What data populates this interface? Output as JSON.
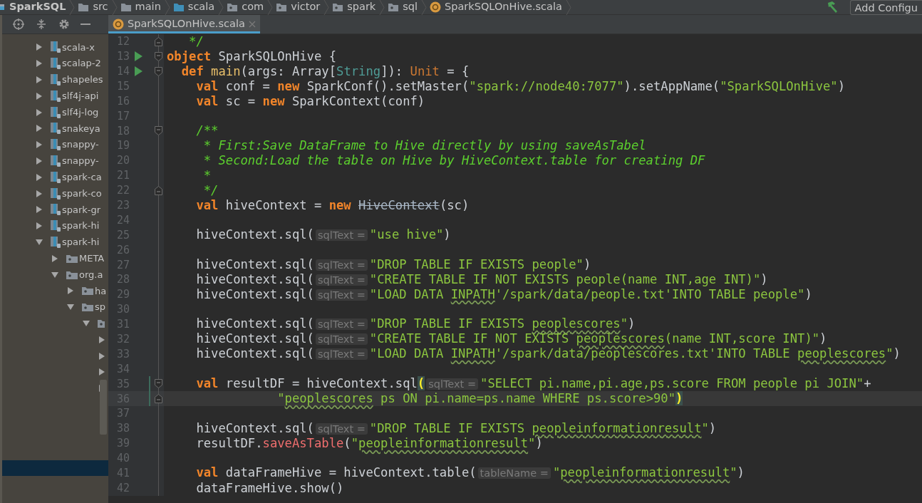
{
  "breadcrumbs": [
    {
      "label": "SparkSQL",
      "kind": "module"
    },
    {
      "label": "src",
      "kind": "folder"
    },
    {
      "label": "main",
      "kind": "folder"
    },
    {
      "label": "scala",
      "kind": "source_folder"
    },
    {
      "label": "com",
      "kind": "package"
    },
    {
      "label": "victor",
      "kind": "package"
    },
    {
      "label": "spark",
      "kind": "package"
    },
    {
      "label": "sql",
      "kind": "package"
    },
    {
      "label": "SparkSQLOnHive.scala",
      "kind": "scala_object"
    }
  ],
  "run_config": {
    "label": "Add Configu"
  },
  "tabs": [
    {
      "label": "SparkSQLOnHive.scala",
      "selected": true
    }
  ],
  "sidebar": {
    "selected_row": true,
    "tree": [
      {
        "label": "scala-x",
        "kind": "jar",
        "expanded": false
      },
      {
        "label": "scalap-2",
        "kind": "jar",
        "expanded": false
      },
      {
        "label": "shapeles",
        "kind": "jar",
        "expanded": false
      },
      {
        "label": "slf4j-api",
        "kind": "jar",
        "expanded": false
      },
      {
        "label": "slf4j-log",
        "kind": "jar",
        "expanded": false
      },
      {
        "label": "snakeya",
        "kind": "jar",
        "expanded": false
      },
      {
        "label": "snappy-",
        "kind": "jar",
        "expanded": false
      },
      {
        "label": "snappy-",
        "kind": "jar",
        "expanded": false
      },
      {
        "label": "spark-ca",
        "kind": "jar",
        "expanded": false
      },
      {
        "label": "spark-co",
        "kind": "jar",
        "expanded": false
      },
      {
        "label": "spark-gr",
        "kind": "jar",
        "expanded": false
      },
      {
        "label": "spark-hi",
        "kind": "jar",
        "expanded": false
      },
      {
        "label": "spark-hi",
        "kind": "jar",
        "expanded": true,
        "children": [
          {
            "label": "META",
            "kind": "package",
            "expanded": false
          },
          {
            "label": "org.a",
            "kind": "package",
            "expanded": true,
            "children": [
              {
                "label": "ha",
                "kind": "package",
                "expanded": false
              },
              {
                "label": "sp",
                "kind": "package",
                "expanded": true,
                "children": [
                  {
                    "kind": "package",
                    "expanded": true,
                    "children": [
                      {
                        "expanded": false
                      },
                      {
                        "expanded": false
                      },
                      {
                        "expanded": false
                      },
                      {
                        "expanded": false
                      }
                    ]
                  }
                ]
              }
            ]
          }
        ]
      }
    ]
  },
  "editor": {
    "lines": [
      {
        "n": "12",
        "fold": {
          "kind": "end"
        },
        "current": false,
        "changed": false,
        "tokens": [
          {
            "kind": "comment",
            "t": "   */"
          }
        ]
      },
      {
        "n": "13",
        "fold": {
          "kind": "start"
        },
        "marker": {
          "kind": "run"
        },
        "current": false,
        "changed": false,
        "tokens": [
          {
            "kind": "keyword",
            "t": "object"
          },
          {
            "kind": "text",
            "t": " SparkSQLOnHive {"
          }
        ]
      },
      {
        "n": "14",
        "fold": {
          "kind": "start"
        },
        "marker": {
          "kind": "run"
        },
        "current": false,
        "changed": false,
        "tokens": [
          {
            "kind": "keyword",
            "t": "  def"
          },
          {
            "kind": "fn",
            "t": " main"
          },
          {
            "kind": "text",
            "t": "(args: Array["
          },
          {
            "kind": "type",
            "t": "String"
          },
          {
            "kind": "text",
            "t": "]): "
          },
          {
            "kind": "unit",
            "t": "Unit"
          },
          {
            "kind": "text",
            "t": " = {"
          }
        ]
      },
      {
        "n": "15",
        "current": false,
        "changed": false,
        "tokens": [
          {
            "kind": "keyword",
            "t": "    val"
          },
          {
            "kind": "text",
            "t": " conf = "
          },
          {
            "kind": "keyword",
            "t": "new"
          },
          {
            "kind": "text",
            "t": " SparkConf().setMaster("
          },
          {
            "kind": "string",
            "t": "\"spark://node40:7077\""
          },
          {
            "kind": "text",
            "t": ").setAppName("
          },
          {
            "kind": "string",
            "t": "\"SparkSQLOnHive\""
          },
          {
            "kind": "text",
            "t": ")"
          }
        ]
      },
      {
        "n": "16",
        "current": false,
        "changed": false,
        "tokens": [
          {
            "kind": "keyword",
            "t": "    val"
          },
          {
            "kind": "text",
            "t": " sc = "
          },
          {
            "kind": "keyword",
            "t": "new"
          },
          {
            "kind": "text",
            "t": " SparkContext(conf)"
          }
        ]
      },
      {
        "n": "17",
        "current": false,
        "changed": false
      },
      {
        "n": "18",
        "fold": {
          "kind": "start"
        },
        "current": false,
        "changed": false,
        "tokens": [
          {
            "kind": "comment",
            "t": "    /**"
          }
        ]
      },
      {
        "n": "19",
        "current": false,
        "changed": false,
        "tokens": [
          {
            "kind": "comment",
            "t": "     * First:Save DataFrame to Hive directly by using saveAsTabel"
          }
        ]
      },
      {
        "n": "20",
        "current": false,
        "changed": false,
        "tokens": [
          {
            "kind": "comment",
            "t": "     * Second:Load the table on Hive by HiveContext.table for creating DF"
          }
        ]
      },
      {
        "n": "21",
        "current": false,
        "changed": false,
        "tokens": [
          {
            "kind": "comment",
            "t": "     *"
          }
        ]
      },
      {
        "n": "22",
        "fold": {
          "kind": "end"
        },
        "current": false,
        "changed": false,
        "tokens": [
          {
            "kind": "comment",
            "t": "     */"
          }
        ]
      },
      {
        "n": "23",
        "current": false,
        "changed": false,
        "tokens": [
          {
            "kind": "keyword",
            "t": "    val"
          },
          {
            "kind": "text",
            "t": " hiveContext = "
          },
          {
            "kind": "keyword",
            "t": "new "
          },
          {
            "kind": "deprecated",
            "t": "HiveContext"
          },
          {
            "kind": "text",
            "t": "(sc)"
          }
        ]
      },
      {
        "n": "24",
        "current": false,
        "changed": false
      },
      {
        "n": "25",
        "current": false,
        "changed": false,
        "tokens": [
          {
            "kind": "text",
            "t": "    hiveContext.sql("
          },
          {
            "kind": "hint",
            "t": "sqlText ="
          },
          {
            "kind": "string",
            "t": "\"use hive\""
          },
          {
            "kind": "text",
            "t": ")"
          }
        ]
      },
      {
        "n": "26",
        "current": false,
        "changed": false
      },
      {
        "n": "27",
        "current": false,
        "changed": false,
        "tokens": [
          {
            "kind": "text",
            "t": "    hiveContext.sql("
          },
          {
            "kind": "hint",
            "t": "sqlText ="
          },
          {
            "kind": "string",
            "t": "\"DROP TABLE IF EXISTS people\""
          },
          {
            "kind": "text",
            "t": ")"
          }
        ]
      },
      {
        "n": "28",
        "current": false,
        "changed": false,
        "tokens": [
          {
            "kind": "text",
            "t": "    hiveContext.sql("
          },
          {
            "kind": "hint",
            "t": "sqlText ="
          },
          {
            "kind": "string",
            "t": "\"CREATE TABLE IF NOT EXISTS people(name INT,age INT)\""
          },
          {
            "kind": "text",
            "t": ")"
          }
        ]
      },
      {
        "n": "29",
        "current": false,
        "changed": false,
        "tokens": [
          {
            "kind": "text",
            "t": "    hiveContext.sql("
          },
          {
            "kind": "hint",
            "t": "sqlText ="
          },
          {
            "kind": "string",
            "t": "\"LOAD DATA "
          },
          {
            "kind": "typo",
            "t": "INPATH"
          },
          {
            "kind": "string",
            "t": "'/spark/data/people.txt'INTO TABLE people\""
          },
          {
            "kind": "text",
            "t": ")"
          }
        ]
      },
      {
        "n": "30",
        "current": false,
        "changed": false
      },
      {
        "n": "31",
        "current": false,
        "changed": false,
        "tokens": [
          {
            "kind": "text",
            "t": "    hiveContext.sql("
          },
          {
            "kind": "hint",
            "t": "sqlText ="
          },
          {
            "kind": "string",
            "t": "\"DROP TABLE IF EXISTS "
          },
          {
            "kind": "typo",
            "t": "peoplescores"
          },
          {
            "kind": "string",
            "t": "\""
          },
          {
            "kind": "text",
            "t": ")"
          }
        ]
      },
      {
        "n": "32",
        "current": false,
        "changed": false,
        "tokens": [
          {
            "kind": "text",
            "t": "    hiveContext.sql("
          },
          {
            "kind": "hint",
            "t": "sqlText ="
          },
          {
            "kind": "string",
            "t": "\"CREATE TABLE IF NOT EXISTS "
          },
          {
            "kind": "typo",
            "t": "peoplescores"
          },
          {
            "kind": "string",
            "t": "(name INT,score INT)\""
          },
          {
            "kind": "text",
            "t": ")"
          }
        ]
      },
      {
        "n": "33",
        "current": false,
        "changed": false,
        "tokens": [
          {
            "kind": "text",
            "t": "    hiveContext.sql("
          },
          {
            "kind": "hint",
            "t": "sqlText ="
          },
          {
            "kind": "string",
            "t": "\"LOAD DATA "
          },
          {
            "kind": "typo",
            "t": "INPATH"
          },
          {
            "kind": "string",
            "t": "'/spark/data/peoplescores.txt'INTO TABLE "
          },
          {
            "kind": "typo",
            "t": "peoplescores"
          },
          {
            "kind": "string",
            "t": "\""
          },
          {
            "kind": "text",
            "t": ")"
          }
        ]
      },
      {
        "n": "34",
        "current": false,
        "changed": false
      },
      {
        "n": "35",
        "fold": {
          "kind": "start"
        },
        "current": false,
        "changed": true,
        "tokens": [
          {
            "kind": "keyword",
            "t": "    val"
          },
          {
            "kind": "text",
            "t": " resultDF = hiveContext.sql"
          },
          {
            "kind": "brace",
            "t": "("
          },
          {
            "kind": "hint",
            "t": "sqlText ="
          },
          {
            "kind": "string",
            "t": "\"SELECT pi.name,pi.age,ps.score FROM people pi JOIN\""
          },
          {
            "kind": "text",
            "t": "+"
          }
        ]
      },
      {
        "n": "36",
        "fold": {
          "kind": "end"
        },
        "current": true,
        "changed": true,
        "tokens": [
          {
            "kind": "string",
            "t": "               \""
          },
          {
            "kind": "typo",
            "t": "peoplescores"
          },
          {
            "kind": "string",
            "t": " ps ON pi.name=ps.name WHERE ps.score>90\""
          },
          {
            "kind": "brace",
            "t": ")"
          }
        ]
      },
      {
        "n": "37",
        "current": false,
        "changed": false
      },
      {
        "n": "38",
        "current": false,
        "changed": false,
        "tokens": [
          {
            "kind": "text",
            "t": "    hiveContext.sql("
          },
          {
            "kind": "hint",
            "t": "sqlText ="
          },
          {
            "kind": "string",
            "t": "\"DROP TABLE IF EXISTS "
          },
          {
            "kind": "typo",
            "t": "peopleinformationresult"
          },
          {
            "kind": "string",
            "t": "\""
          },
          {
            "kind": "text",
            "t": ")"
          }
        ]
      },
      {
        "n": "39",
        "current": false,
        "changed": false,
        "tokens": [
          {
            "kind": "text",
            "t": "    resultDF."
          },
          {
            "kind": "method",
            "t": "saveAsTable"
          },
          {
            "kind": "text",
            "t": "("
          },
          {
            "kind": "string",
            "t": "\""
          },
          {
            "kind": "typo",
            "t": "peopleinformationresult"
          },
          {
            "kind": "string",
            "t": "\""
          },
          {
            "kind": "text",
            "t": ")"
          }
        ]
      },
      {
        "n": "40",
        "current": false,
        "changed": false
      },
      {
        "n": "41",
        "current": false,
        "changed": false,
        "tokens": [
          {
            "kind": "keyword",
            "t": "    val"
          },
          {
            "kind": "text",
            "t": " dataFrameHive = hiveContext.table("
          },
          {
            "kind": "hint",
            "t": "tableName ="
          },
          {
            "kind": "string",
            "t": "\""
          },
          {
            "kind": "typo",
            "t": "peopleinformationresult"
          },
          {
            "kind": "string",
            "t": "\""
          },
          {
            "kind": "text",
            "t": ")"
          }
        ]
      },
      {
        "n": "42",
        "current": false,
        "changed": false,
        "tokens": [
          {
            "kind": "text",
            "t": "    dataFrameHive.show()"
          }
        ]
      }
    ]
  }
}
